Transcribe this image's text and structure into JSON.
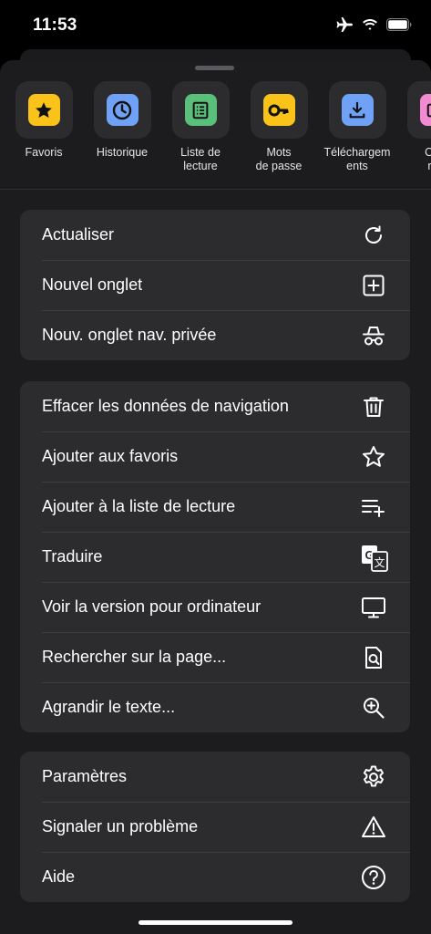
{
  "status": {
    "time": "11:53"
  },
  "shortcuts": [
    {
      "label": "Favoris",
      "icon": "star-icon",
      "color": "#f9c31a"
    },
    {
      "label": "Historique",
      "icon": "clock-icon",
      "color": "#6fa1f7"
    },
    {
      "label": "Liste de\nlecture",
      "icon": "reading-list-icon",
      "color": "#5bbf7c"
    },
    {
      "label": "Mots\nde passe",
      "icon": "key-icon",
      "color": "#f9c31a"
    },
    {
      "label": "Téléchargem\nents",
      "icon": "download-icon",
      "color": "#6fa1f7"
    },
    {
      "label": "Ong\nréc",
      "icon": "recent-tabs-icon",
      "color": "#f28bd1"
    }
  ],
  "groups": [
    {
      "items": [
        {
          "label": "Actualiser",
          "icon": "refresh-icon"
        },
        {
          "label": "Nouvel onglet",
          "icon": "new-tab-icon"
        },
        {
          "label": "Nouv. onglet nav. privée",
          "icon": "incognito-icon"
        }
      ]
    },
    {
      "items": [
        {
          "label": "Effacer les données de navigation",
          "icon": "trash-icon"
        },
        {
          "label": "Ajouter aux favoris",
          "icon": "star-outline-icon"
        },
        {
          "label": "Ajouter à la liste de lecture",
          "icon": "add-to-list-icon"
        },
        {
          "label": "Traduire",
          "icon": "translate-icon"
        },
        {
          "label": "Voir la version pour ordinateur",
          "icon": "desktop-icon"
        },
        {
          "label": "Rechercher sur la page...",
          "icon": "find-in-page-icon"
        },
        {
          "label": "Agrandir le texte...",
          "icon": "zoom-in-icon"
        }
      ]
    },
    {
      "items": [
        {
          "label": "Paramètres",
          "icon": "gear-icon"
        },
        {
          "label": "Signaler un problème",
          "icon": "warning-icon"
        },
        {
          "label": "Aide",
          "icon": "help-icon"
        }
      ]
    }
  ]
}
